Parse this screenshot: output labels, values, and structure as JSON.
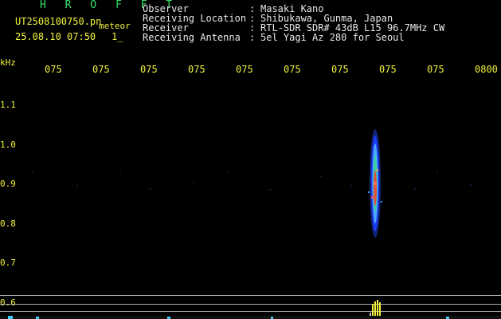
{
  "header": {
    "app_name": "H R O F F T",
    "filename": "UT2508100750.pn",
    "filename_tag": "meteor",
    "datetime": "25.08.10 07:50",
    "counter": "1_"
  },
  "station": {
    "rows": [
      {
        "label": "Observer",
        "value": "Masaki Kano"
      },
      {
        "label": "Receiving Location",
        "value": "Shibukawa, Gunma, Japan"
      },
      {
        "label": "Receiver",
        "value": "RTL-SDR SDR# 43dB L15 96.7MHz CW"
      },
      {
        "label": "Receiving Antenna",
        "value": "5el Yagi Az 280 for Seoul"
      }
    ],
    "separator": ":"
  },
  "axes": {
    "y_unit": "kHz",
    "y_ticks": [
      "1.1",
      "1.0",
      "0.9",
      "0.8",
      "0.7",
      "0.6"
    ],
    "x_ticks": [
      "075",
      "075",
      "075",
      "075",
      "075",
      "075",
      "075",
      "075",
      "075",
      "0800"
    ]
  },
  "colors": {
    "grid": "#2a2a4a",
    "axis_text": "#f2f23c",
    "header_text": "#36e06a",
    "meteor_core": "#e2503a",
    "meteor_mid": "#4aa8ff",
    "meteor_outer": "#1d3cff"
  }
}
